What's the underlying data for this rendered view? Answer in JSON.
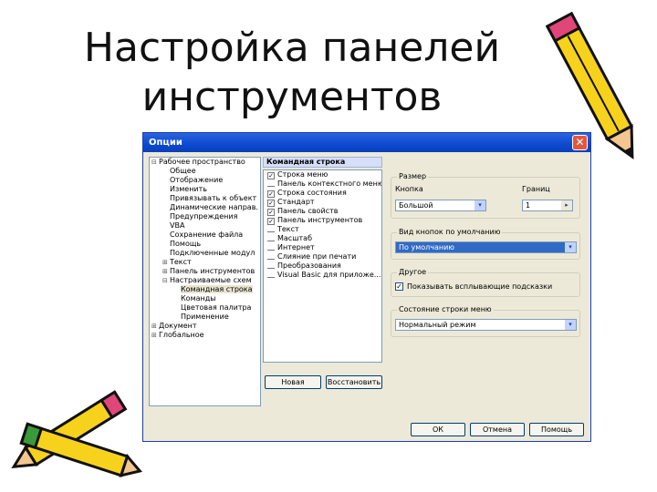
{
  "slide": {
    "title_line1": "Настройка панелей",
    "title_line2": "инструментов"
  },
  "dialog": {
    "title": "Опции",
    "close_glyph": "✕",
    "tree": [
      {
        "label": "Рабочее пространство",
        "exp": "⊟",
        "indent": 0
      },
      {
        "label": "Общее",
        "exp": "",
        "indent": 1
      },
      {
        "label": "Отображение",
        "exp": "",
        "indent": 1
      },
      {
        "label": "Изменить",
        "exp": "",
        "indent": 1
      },
      {
        "label": "Привязывать к объект",
        "exp": "",
        "indent": 1
      },
      {
        "label": "Динамические направ.",
        "exp": "",
        "indent": 1
      },
      {
        "label": "Предупреждения",
        "exp": "",
        "indent": 1
      },
      {
        "label": "VBA",
        "exp": "",
        "indent": 1
      },
      {
        "label": "Сохранение файла",
        "exp": "",
        "indent": 1
      },
      {
        "label": "Помощь",
        "exp": "",
        "indent": 1
      },
      {
        "label": "Подключенные модул",
        "exp": "",
        "indent": 1
      },
      {
        "label": "Текст",
        "exp": "⊞",
        "indent": 1
      },
      {
        "label": "Панель инструментов",
        "exp": "⊞",
        "indent": 1
      },
      {
        "label": "Настраиваемые схем",
        "exp": "⊟",
        "indent": 1
      },
      {
        "label": "Командная строка",
        "exp": "",
        "indent": 2,
        "selected": true
      },
      {
        "label": "Команды",
        "exp": "",
        "indent": 2
      },
      {
        "label": "Цветовая палитра",
        "exp": "",
        "indent": 2
      },
      {
        "label": "Применение",
        "exp": "",
        "indent": 2
      },
      {
        "label": "Документ",
        "exp": "⊞",
        "indent": 0
      },
      {
        "label": "Глобальное",
        "exp": "⊞",
        "indent": 0
      }
    ],
    "commands_header": "Командная строка",
    "commands": [
      {
        "label": "Строка меню",
        "checked": true
      },
      {
        "label": "Панель контекстного меню",
        "checked": false
      },
      {
        "label": "Строка состояния",
        "checked": true
      },
      {
        "label": "Стандарт",
        "checked": true
      },
      {
        "label": "Панель свойств",
        "checked": true
      },
      {
        "label": "Панель инструментов",
        "checked": true
      },
      {
        "label": "Текст",
        "checked": false
      },
      {
        "label": "Масштаб",
        "checked": false
      },
      {
        "label": "Интернет",
        "checked": false
      },
      {
        "label": "Слияние при печати",
        "checked": false
      },
      {
        "label": "Преобразования",
        "checked": false
      },
      {
        "label": "Visual Basic для приложе...",
        "checked": false
      }
    ],
    "new_button": "Новая",
    "reset_button": "Восстановить",
    "size_group": {
      "label": "Размер",
      "button_label": "Кнопка",
      "button_value": "Большой",
      "border_label": "Границ",
      "border_value": "1"
    },
    "default_view_group": {
      "label": "Вид кнопок по умолчанию",
      "value": "По умолчанию"
    },
    "other_group": {
      "label": "Другое",
      "tooltip_option": "Показывать всплывающие подсказки",
      "tooltip_checked": true
    },
    "state_group": {
      "label": "Состояние строки меню",
      "value": "Нормальный режим"
    },
    "ok_button": "ОК",
    "cancel_button": "Отмена",
    "help_button": "Помощь",
    "arrow_glyph": "▾",
    "check_glyph": "✓",
    "slider_glyph": "▸"
  }
}
